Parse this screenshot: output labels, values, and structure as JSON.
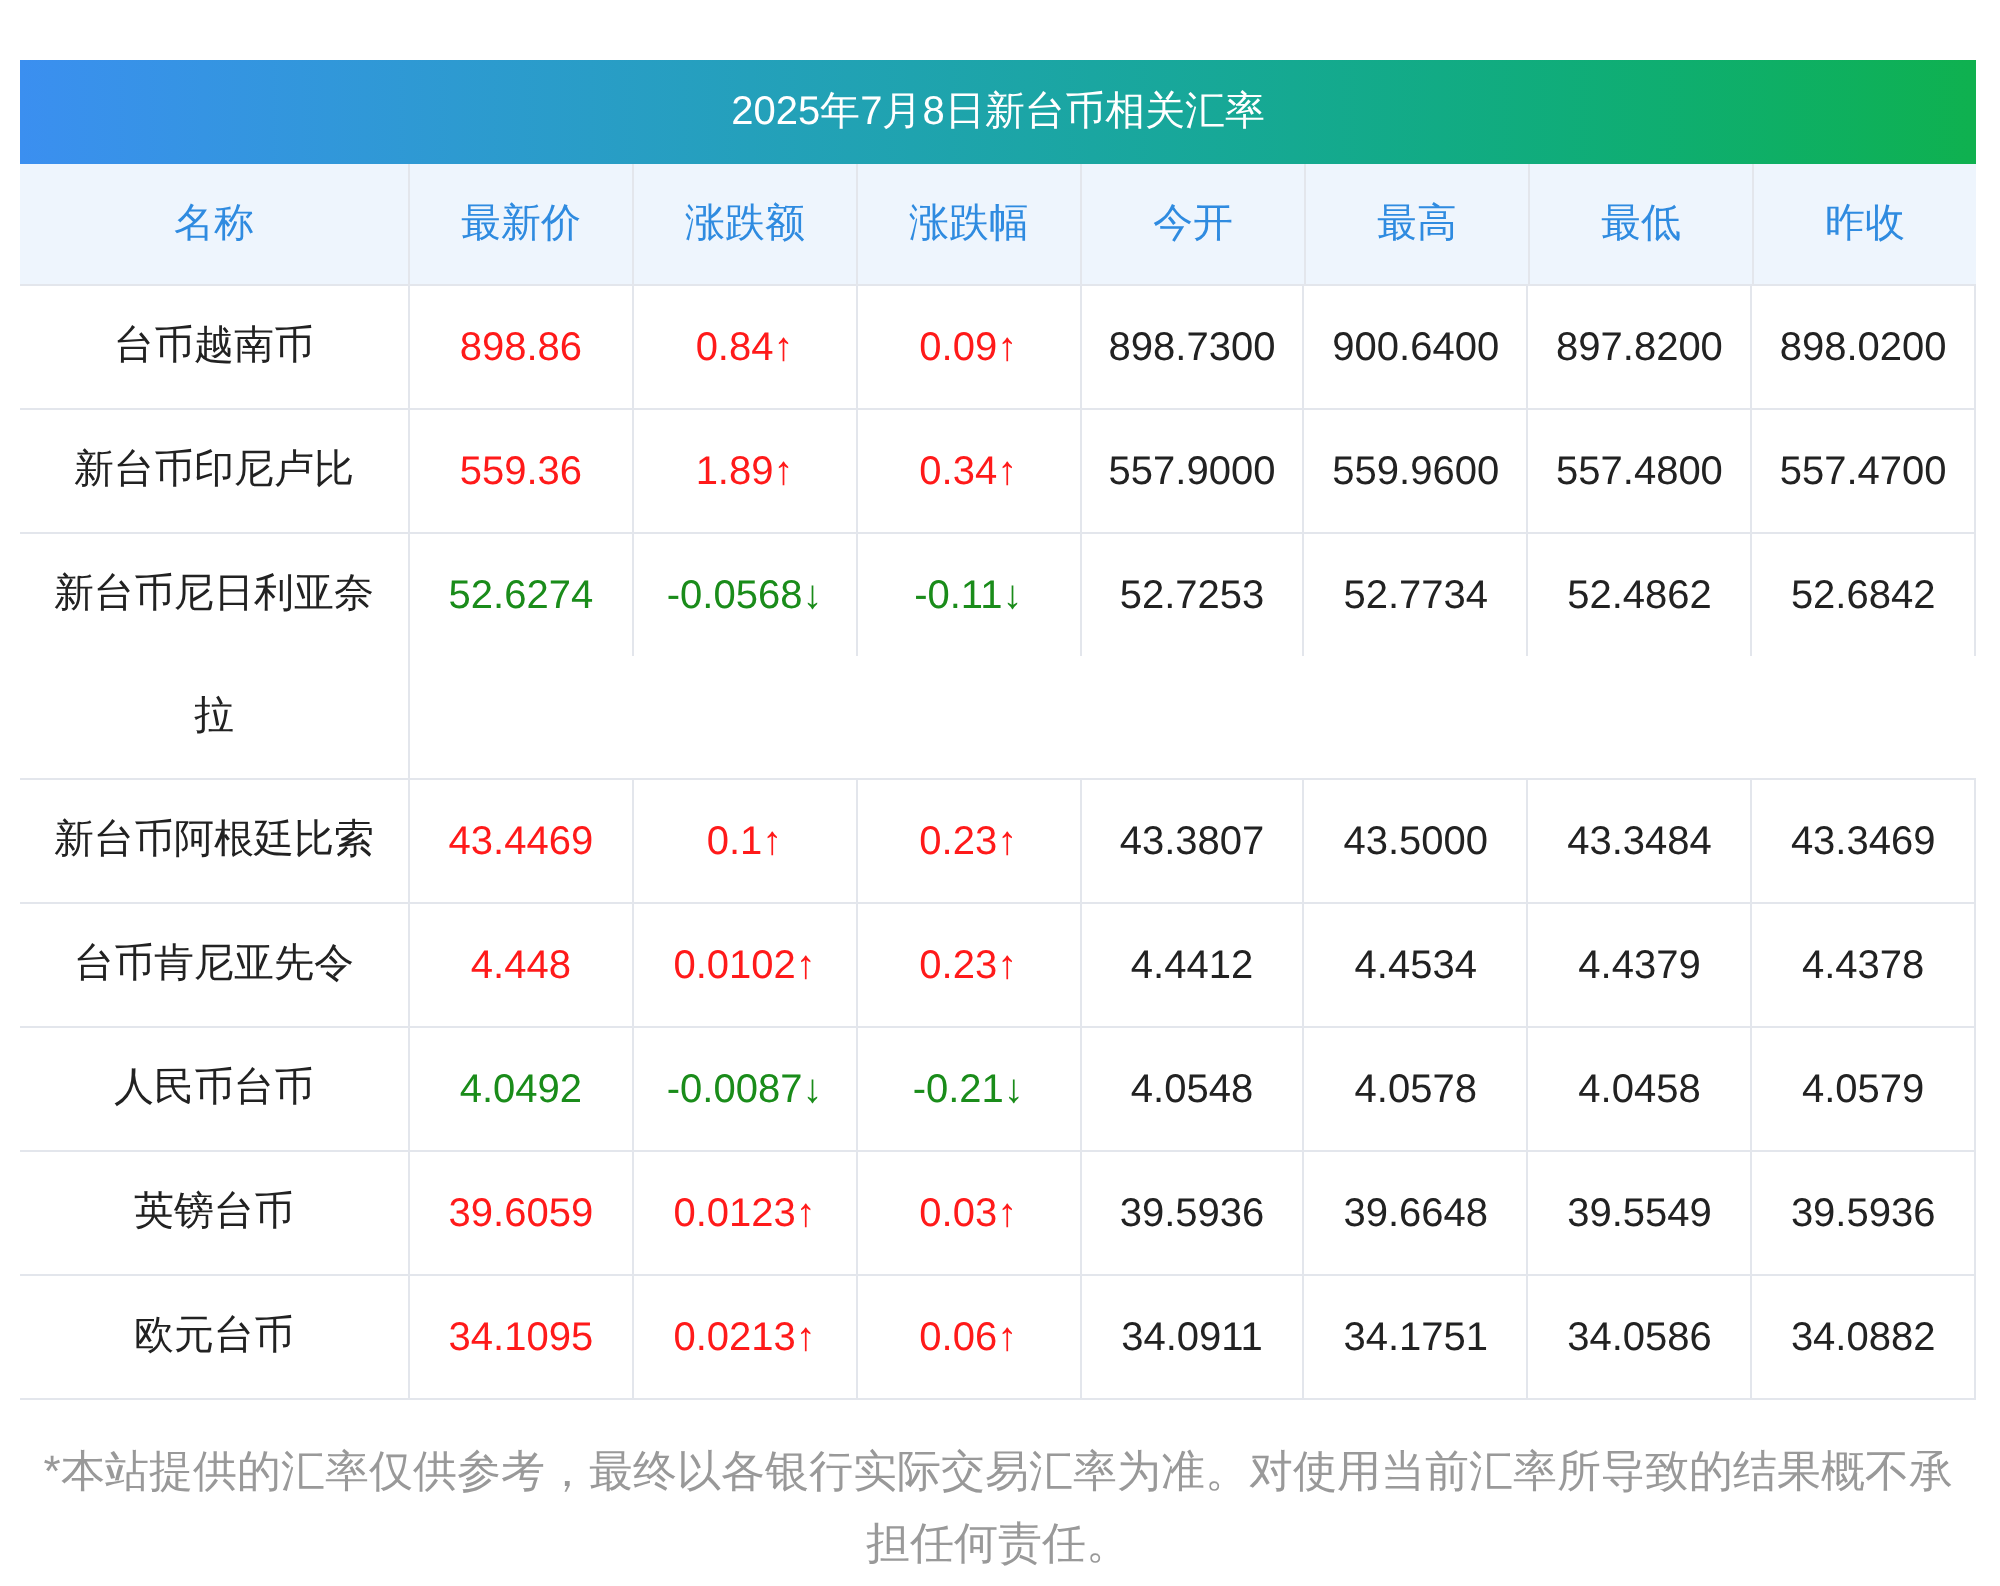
{
  "title": "2025年7月8日新台币相关汇率",
  "columns": [
    "名称",
    "最新价",
    "涨跌额",
    "涨跌幅",
    "今开",
    "最高",
    "最低",
    "昨收"
  ],
  "rows": [
    {
      "name": "台币越南币",
      "rising": true,
      "cells": [
        "898.86",
        "0.84↑",
        "0.09↑",
        "898.7300",
        "900.6400",
        "897.8200",
        "898.0200"
      ]
    },
    {
      "name": "新台币印尼卢比",
      "rising": true,
      "cells": [
        "559.36",
        "1.89↑",
        "0.34↑",
        "557.9000",
        "559.9600",
        "557.4800",
        "557.4700"
      ]
    },
    {
      "name": "新台币尼日利亚奈拉",
      "rising": false,
      "cells": [
        "52.6274",
        "-0.0568↓",
        "-0.11↓",
        "52.7253",
        "52.7734",
        "52.4862",
        "52.6842"
      ]
    },
    {
      "name": "新台币阿根廷比索",
      "rising": true,
      "cells": [
        "43.4469",
        "0.1↑",
        "0.23↑",
        "43.3807",
        "43.5000",
        "43.3484",
        "43.3469"
      ]
    },
    {
      "name": "台币肯尼亚先令",
      "rising": true,
      "cells": [
        "4.448",
        "0.0102↑",
        "0.23↑",
        "4.4412",
        "4.4534",
        "4.4379",
        "4.4378"
      ]
    },
    {
      "name": "人民币台币",
      "rising": false,
      "cells": [
        "4.0492",
        "-0.0087↓",
        "-0.21↓",
        "4.0548",
        "4.0578",
        "4.0458",
        "4.0579"
      ]
    },
    {
      "name": "英镑台币",
      "rising": true,
      "cells": [
        "39.6059",
        "0.0123↑",
        "0.03↑",
        "39.5936",
        "39.6648",
        "39.5549",
        "39.5936"
      ]
    },
    {
      "name": "欧元台币",
      "rising": true,
      "cells": [
        "34.1095",
        "0.0213↑",
        "0.06↑",
        "34.0911",
        "34.1751",
        "34.0586",
        "34.0882"
      ]
    }
  ],
  "note": "*本站提供的汇率仅供参考，最终以各银行实际交易汇率为准。对使用当前汇率所导致的结果概不承担任何责任。"
}
